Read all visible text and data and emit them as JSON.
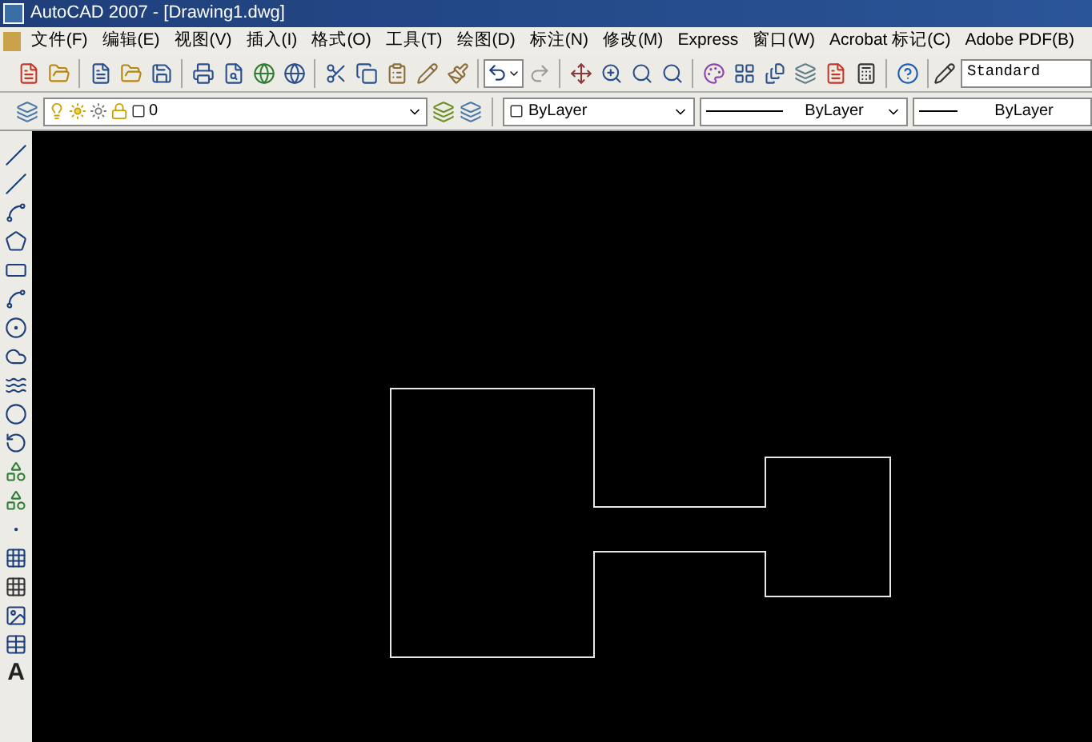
{
  "window": {
    "title": "AutoCAD 2007 - [Drawing1.dwg]"
  },
  "menu": [
    "文件(F)",
    "编辑(E)",
    "视图(V)",
    "插入(I)",
    "格式(O)",
    "工具(T)",
    "绘图(D)",
    "标注(N)",
    "修改(M)",
    "Express",
    "窗口(W)",
    "Acrobat 标记(C)",
    "Adobe PDF(B)"
  ],
  "styles_toolbar": {
    "text_style": "Standard"
  },
  "layers_toolbar": {
    "layer": "0"
  },
  "properties_toolbar": {
    "color_control": "ByLayer",
    "linetype": "ByLayer",
    "lineweight": "ByLayer"
  },
  "draw_toolbar": {
    "text_tool": "A"
  }
}
